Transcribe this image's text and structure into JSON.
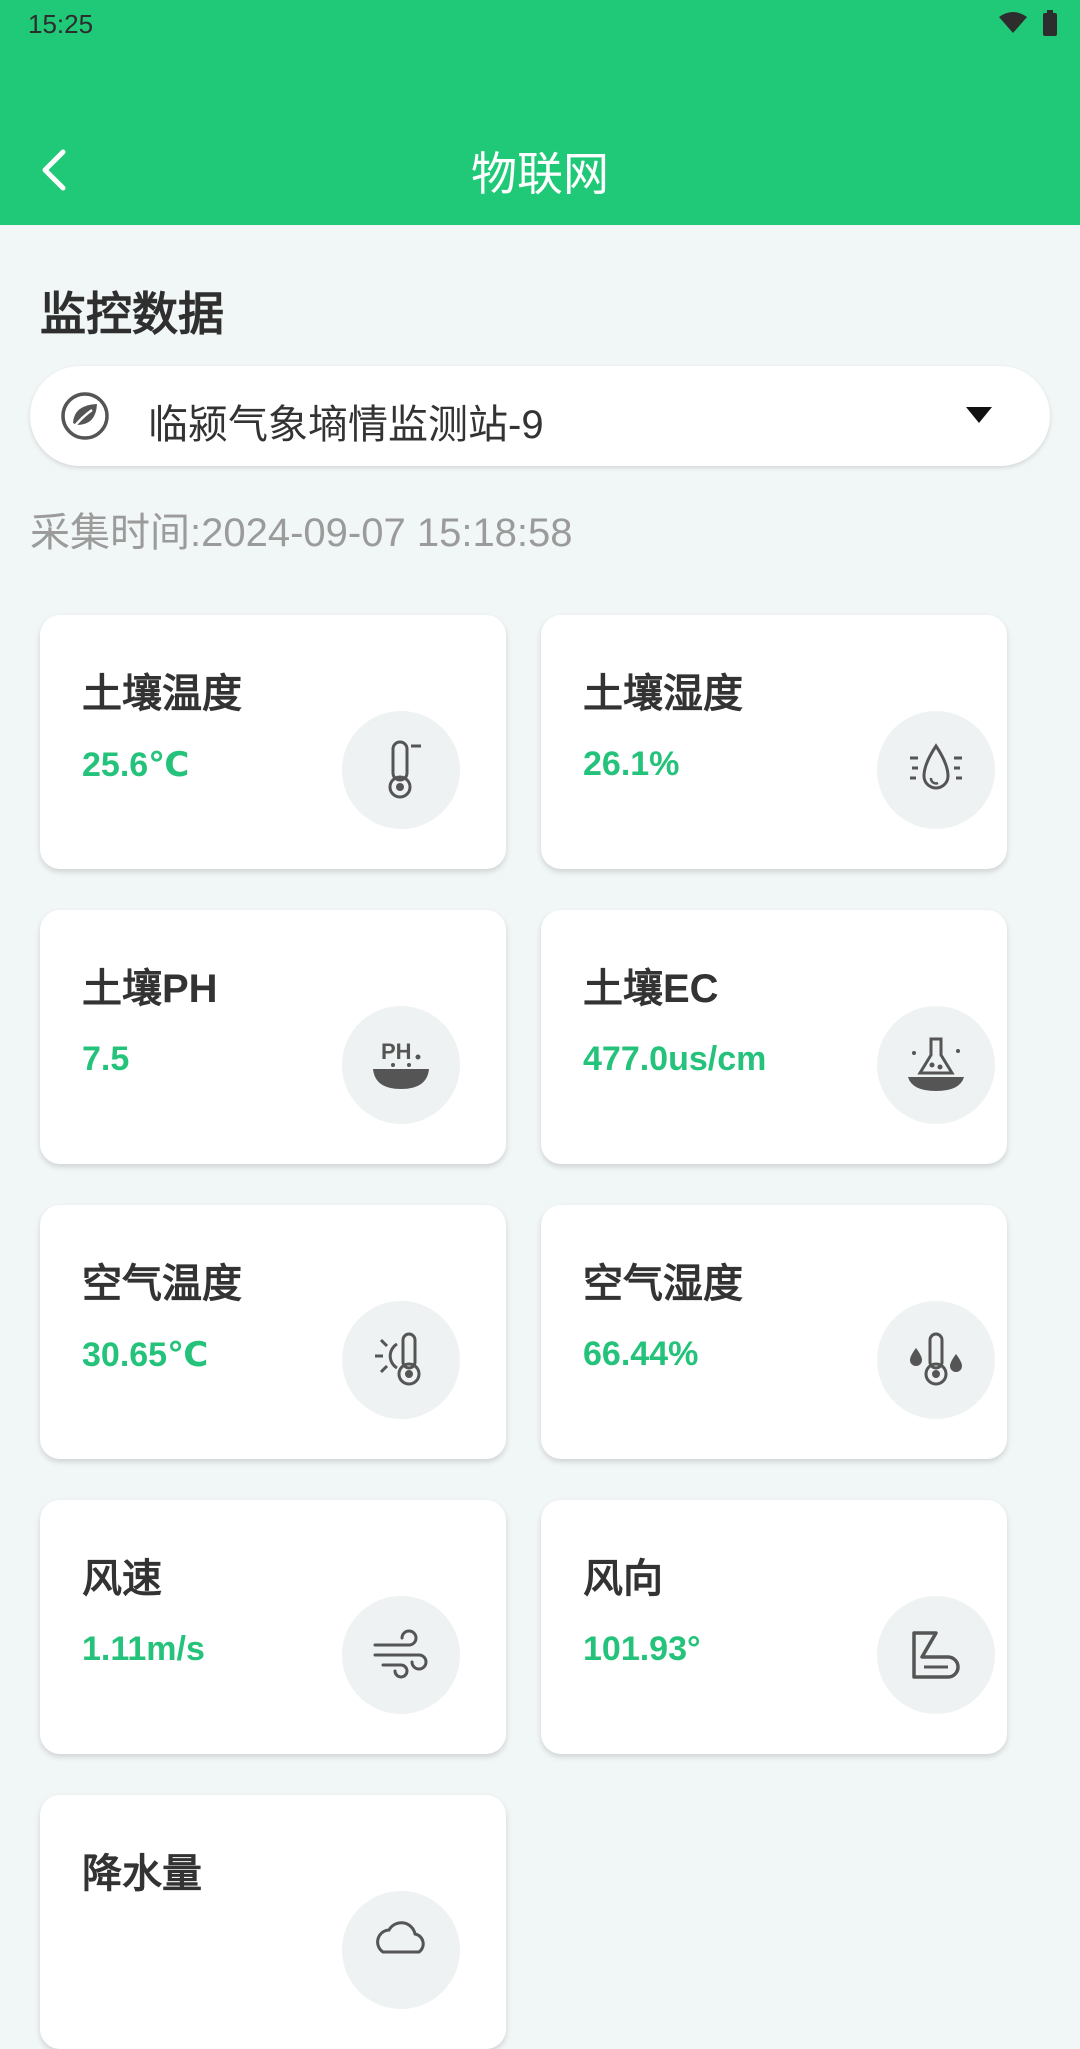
{
  "status_bar": {
    "time": "15:25"
  },
  "app_bar": {
    "title": "物联网"
  },
  "section": {
    "title": "监控数据"
  },
  "station": {
    "name": "临颍气象墒情监测站-9"
  },
  "collect_time": "采集时间:2024-09-07 15:18:58",
  "colors": {
    "primary": "#20c978",
    "value_text": "#24c27a",
    "background": "#f1f6f6"
  },
  "metrics": [
    {
      "label": "土壤温度",
      "value": "25.6℃",
      "icon": "thermometer-icon"
    },
    {
      "label": "土壤湿度",
      "value": "26.1%",
      "icon": "water-drop-icon"
    },
    {
      "label": "土壤PH",
      "value": "7.5",
      "icon": "ph-icon"
    },
    {
      "label": "土壤EC",
      "value": "477.0us/cm",
      "icon": "flask-icon"
    },
    {
      "label": "空气温度",
      "value": "30.65℃",
      "icon": "sun-thermometer-icon"
    },
    {
      "label": "空气湿度",
      "value": "66.44%",
      "icon": "drops-thermometer-icon"
    },
    {
      "label": "风速",
      "value": "1.11m/s",
      "icon": "wind-icon"
    },
    {
      "label": "风向",
      "value": "101.93°",
      "icon": "wind-direction-icon"
    },
    {
      "label": "降水量",
      "value": "",
      "icon": "rain-icon"
    }
  ]
}
